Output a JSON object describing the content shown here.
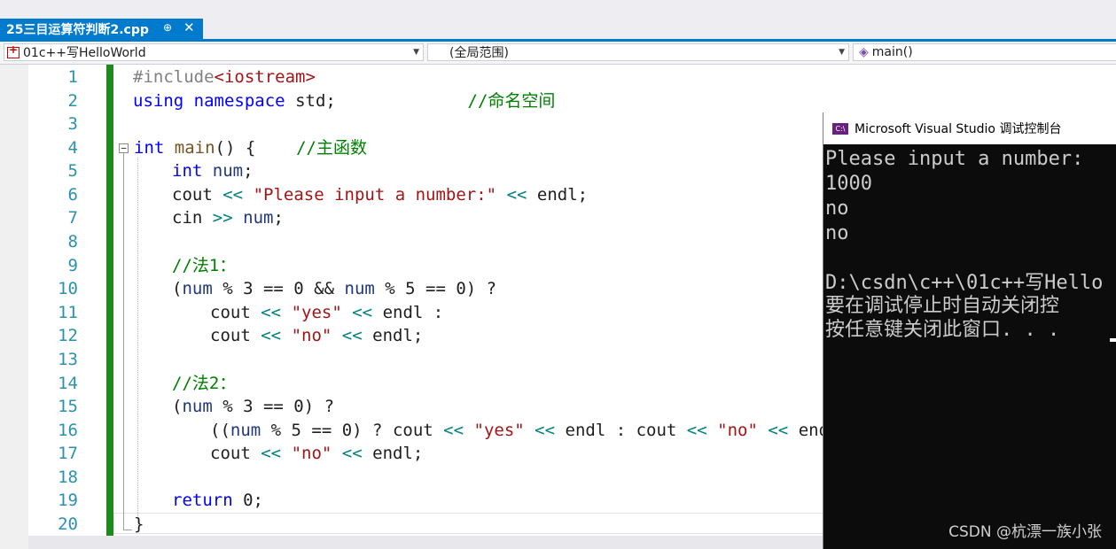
{
  "tab": {
    "title": "25三目运算符判断2.cpp",
    "pin": "⊕",
    "close": "✕"
  },
  "nav": {
    "project": "01c++写HelloWorld",
    "scope": "(全局范围)",
    "member": "main()"
  },
  "line_numbers": [
    "1",
    "2",
    "3",
    "4",
    "5",
    "6",
    "7",
    "8",
    "9",
    "10",
    "11",
    "12",
    "13",
    "14",
    "15",
    "16",
    "17",
    "18",
    "19",
    "20"
  ],
  "code": {
    "l1": {
      "pp": "#include",
      "inc": "<iostream>"
    },
    "l2": {
      "kw1": "using",
      "kw2": "namespace",
      "id": "std;",
      "cm": "//命名空间"
    },
    "l4": {
      "kw": "int",
      "fn": "main",
      "rest": "() {",
      "cm": "//主函数"
    },
    "l5": {
      "kw": "int",
      "var": "num",
      "rest": ";"
    },
    "l6": {
      "a": "cout",
      "op1": "<<",
      "str": "\"Please input a number:\"",
      "op2": "<<",
      "b": "endl;"
    },
    "l7": {
      "a": "cin",
      "op": ">>",
      "var": "num",
      "rest": ";"
    },
    "l9": {
      "cm": "//法1："
    },
    "l10": {
      "p": "(",
      "v1": "num",
      "r1": " % 3 == 0 && ",
      "v2": "num",
      "r2": " % 5 == 0) ?"
    },
    "l11": {
      "a": "cout",
      "op1": "<<",
      "str": "\"yes\"",
      "op2": "<<",
      "b": "endl :"
    },
    "l12": {
      "a": "cout",
      "op1": "<<",
      "str": "\"no\"",
      "op2": "<<",
      "b": "endl;"
    },
    "l14": {
      "cm": "//法2："
    },
    "l15": {
      "p": "(",
      "v": "num",
      "r": " % 3 == 0) ?"
    },
    "l16": {
      "p": "((",
      "v": "num",
      "r1": " % 5 == 0) ? ",
      "a": "cout",
      "op1": "<<",
      "s1": "\"yes\"",
      "op2": "<<",
      "b": "endl : ",
      "c": "cout",
      "op3": "<<",
      "s2": "\"no\"",
      "op4": "<<",
      "d": "endl)"
    },
    "l17": {
      "a": "cout",
      "op1": "<<",
      "str": "\"no\"",
      "op2": "<<",
      "b": "endl;"
    },
    "l19": {
      "kw": "return",
      "rest": "0;"
    },
    "l20": {
      "brace": "}"
    }
  },
  "console": {
    "title": "Microsoft Visual Studio 调试控制台",
    "icon_text": "C:\\",
    "lines": [
      "Please input a number:",
      "1000",
      "no",
      "no",
      "",
      "D:\\csdn\\c++\\01c++写Hello",
      "要在调试停止时自动关闭控",
      "按任意键关闭此窗口. . ."
    ]
  },
  "watermark": "CSDN @杭漂一族小张",
  "colors": {
    "accent": "#007acc",
    "keyword": "#0000ff",
    "string": "#a31515",
    "comment": "#008000",
    "line_number": "#2b91af",
    "change_bar": "#1e8a1e"
  }
}
